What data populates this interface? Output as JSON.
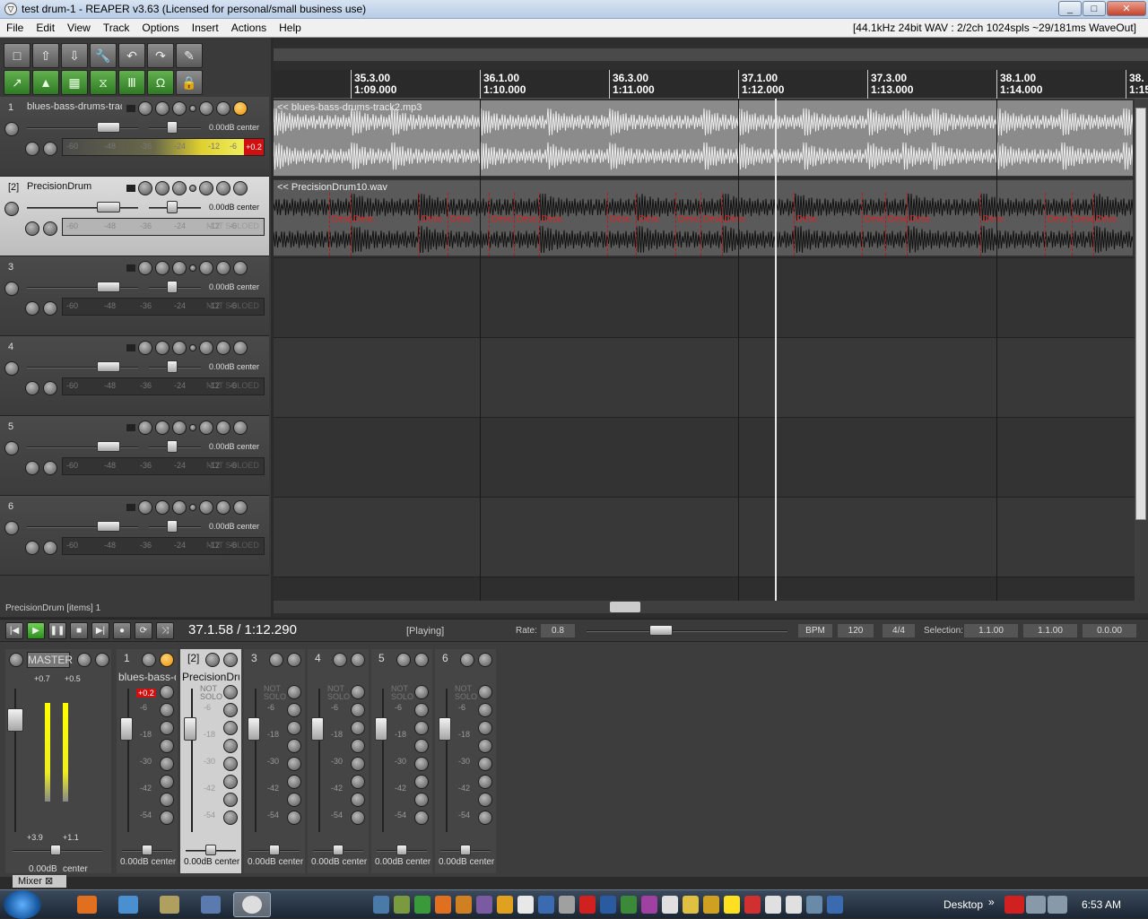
{
  "window": {
    "title": "test drum-1 - REAPER v3.63 (Licensed for personal/small business use)",
    "minimize": "_",
    "maximize": "□",
    "close": "✕"
  },
  "menu": {
    "items": [
      "File",
      "Edit",
      "View",
      "Track",
      "Options",
      "Insert",
      "Actions",
      "Help"
    ],
    "status": "[44.1kHz 24bit WAV : 2/2ch 1024spls ~29/181ms WaveOut]"
  },
  "toolbar": {
    "row1": [
      "□",
      "⇧",
      "⇩",
      "🔧",
      "↶",
      "↷",
      "✎"
    ],
    "row2": [
      "↗",
      "▲",
      "▦",
      "⧖",
      "Ⅲ",
      "Ω",
      "🔒"
    ]
  },
  "tracks": [
    {
      "num": "1",
      "name": "blues-bass-drums-track",
      "vol": "0.00dB center",
      "meter_clip": "+0.2",
      "meter_level": 0.92,
      "meter_ticks": [
        "-60",
        "-48",
        "-36",
        "-24",
        "-12",
        "-6"
      ]
    },
    {
      "num": "[2]",
      "name": "PrecisionDrum",
      "vol": "0.00dB center",
      "meter_ticks": [
        "-60",
        "-48",
        "-36",
        "-24",
        "-12",
        "-6"
      ],
      "meter_overlay": "NOT SOLOED"
    },
    {
      "num": "3",
      "name": "",
      "vol": "0.00dB center",
      "meter_ticks": [
        "-60",
        "-48",
        "-36",
        "-24",
        "-12",
        "-6"
      ],
      "meter_overlay": "NOT SOLOED"
    },
    {
      "num": "4",
      "name": "",
      "vol": "0.00dB center",
      "meter_ticks": [
        "-60",
        "-48",
        "-36",
        "-24",
        "-12",
        "-6"
      ],
      "meter_overlay": "NOT SOLOED"
    },
    {
      "num": "5",
      "name": "",
      "vol": "0.00dB center",
      "meter_ticks": [
        "-60",
        "-48",
        "-36",
        "-24",
        "-12",
        "-6"
      ],
      "meter_overlay": "NOT SOLOED"
    },
    {
      "num": "6",
      "name": "",
      "vol": "0.00dB center",
      "meter_ticks": [
        "-60",
        "-48",
        "-36",
        "-24",
        "-12",
        "-6"
      ],
      "meter_overlay": "NOT SOLOED"
    }
  ],
  "item_count": "PrecisionDrum [items] 1",
  "ruler": [
    {
      "bar": "35.3.00",
      "time": "1:09.000"
    },
    {
      "bar": "36.1.00",
      "time": "1:10.000"
    },
    {
      "bar": "36.3.00",
      "time": "1:11.000"
    },
    {
      "bar": "37.1.00",
      "time": "1:12.000"
    },
    {
      "bar": "37.3.00",
      "time": "1:13.000"
    },
    {
      "bar": "38.1.00",
      "time": "1:14.000"
    },
    {
      "bar": "38.",
      "time": "1:15"
    }
  ],
  "items": {
    "track1": "<< blues-bass-drums-track2.mp3",
    "track2": "<< PrecisionDrum10.wav",
    "marker_label": "Desc."
  },
  "transport": {
    "buttons": [
      "|◀",
      "▶",
      "❚❚",
      "■",
      "▶|",
      "●",
      "⟳",
      "⤨"
    ],
    "position": "37.1.58 / 1:12.290",
    "state": "[Playing]",
    "rate_label": "Rate:",
    "rate": "0.8",
    "bpm_label": "BPM",
    "bpm": "120",
    "sig": "4/4",
    "selection_label": "Selection:",
    "sel_start": "1.1.00",
    "sel_end": "1.1.00",
    "sel_len": "0.0.00"
  },
  "mixer": {
    "master": {
      "name": "MASTER",
      "peak_l": "+0.7",
      "peak_r": "+0.5",
      "scale": [
        "12",
        "6",
        "0",
        "6",
        "12",
        "18",
        "24",
        "30",
        "36",
        "42"
      ],
      "inner": [
        "-6",
        "-18",
        "-30",
        "-42",
        "-54"
      ],
      "bottom_l": "+3.9",
      "bottom_r": "+1.1",
      "vol": "0.00dB",
      "pan": "center"
    },
    "strips": [
      {
        "num": "1",
        "name": "blues-bass-drums",
        "clip": "+0.2",
        "vol": "0.00dB center"
      },
      {
        "num": "[2]",
        "name": "PrecisionDrum",
        "vol": "0.00dB center"
      },
      {
        "num": "3",
        "name": "",
        "vol": "0.00dB center"
      },
      {
        "num": "4",
        "name": "",
        "vol": "0.00dB center"
      },
      {
        "num": "5",
        "name": "",
        "vol": "0.00dB center"
      },
      {
        "num": "6",
        "name": "",
        "vol": "0.00dB center"
      }
    ],
    "strip_ticks": [
      "-6",
      "-18",
      "-30",
      "-42",
      "-54"
    ],
    "not_soloed": "NOT SOLO",
    "tab": "Mixer",
    "tab_close": "⊠"
  },
  "taskbar": {
    "desktop": "Desktop",
    "clock": "6:53 AM",
    "chevron": "»"
  }
}
